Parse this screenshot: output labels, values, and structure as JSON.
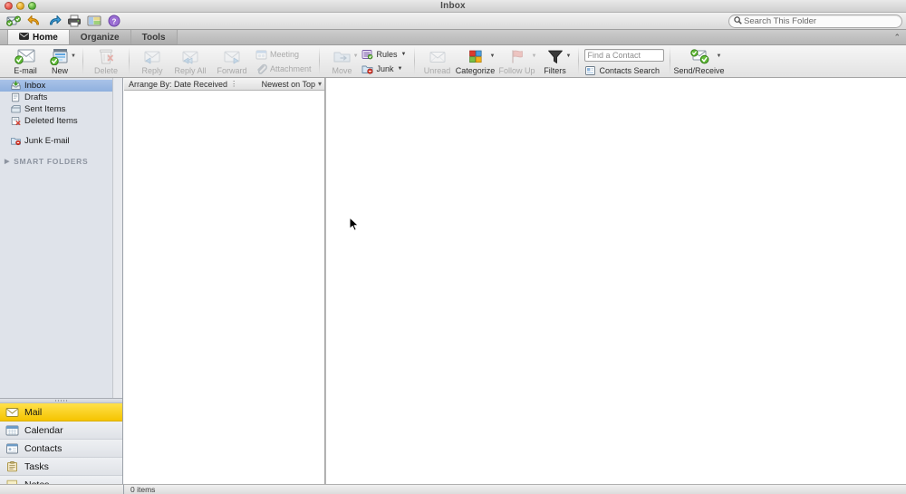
{
  "window": {
    "title": "Inbox",
    "controls": [
      "close",
      "minimize",
      "zoom"
    ]
  },
  "toolbar": {
    "icons": [
      {
        "name": "send-receive-icon",
        "label": "Send/Receive"
      },
      {
        "name": "undo-icon",
        "label": "Undo"
      },
      {
        "name": "redo-icon",
        "label": "Redo"
      },
      {
        "name": "print-icon",
        "label": "Print"
      },
      {
        "name": "sidebar-toggle-icon",
        "label": "View"
      },
      {
        "name": "help-icon",
        "label": "Help"
      }
    ],
    "search": {
      "placeholder": "Search This Folder",
      "value": "",
      "icon": "search-icon"
    }
  },
  "ribbon": {
    "tabs": [
      {
        "label": "Home",
        "active": true,
        "icon": "envelope-icon"
      },
      {
        "label": "Organize",
        "active": false
      },
      {
        "label": "Tools",
        "active": false
      }
    ],
    "collapse_glyph": "⌃",
    "groups": [
      {
        "name": "new-group",
        "buttons": [
          {
            "label": "E-mail",
            "icon": "new-email-icon",
            "disabled": false,
            "dropdown": false
          },
          {
            "label": "New",
            "icon": "new-item-icon",
            "disabled": false,
            "dropdown": true
          }
        ]
      },
      {
        "name": "delete-group",
        "buttons": [
          {
            "label": "Delete",
            "icon": "trash-icon",
            "disabled": true,
            "dropdown": false
          }
        ]
      },
      {
        "name": "respond-group",
        "buttons": [
          {
            "label": "Reply",
            "icon": "reply-icon",
            "disabled": true,
            "dropdown": false
          },
          {
            "label": "Reply All",
            "icon": "reply-all-icon",
            "disabled": true,
            "dropdown": false
          },
          {
            "label": "Forward",
            "icon": "forward-icon",
            "disabled": true,
            "dropdown": false
          }
        ],
        "stacked": [
          {
            "label": "Meeting",
            "icon": "meeting-icon",
            "disabled": true
          },
          {
            "label": "Attachment",
            "icon": "attachment-icon",
            "disabled": true
          }
        ]
      },
      {
        "name": "move-group",
        "buttons": [
          {
            "label": "Move",
            "icon": "move-folder-icon",
            "disabled": true,
            "dropdown": true
          }
        ],
        "stacked": [
          {
            "label": "Rules",
            "icon": "rules-icon",
            "disabled": false,
            "dropdown": true
          },
          {
            "label": "Junk",
            "icon": "junk-icon",
            "disabled": false,
            "dropdown": true
          }
        ]
      },
      {
        "name": "tags-group",
        "buttons": [
          {
            "label": "Unread",
            "icon": "unread-envelope-icon",
            "disabled": true,
            "dropdown": false
          },
          {
            "label": "Categorize",
            "icon": "categorize-icon",
            "disabled": false,
            "dropdown": true
          },
          {
            "label": "Follow Up",
            "icon": "flag-icon",
            "disabled": true,
            "dropdown": true
          },
          {
            "label": "Filters",
            "icon": "funnel-icon",
            "disabled": false,
            "dropdown": true
          }
        ]
      },
      {
        "name": "find-group",
        "find_contact": {
          "placeholder": "Find a Contact",
          "value": ""
        },
        "contacts_search": {
          "label": "Contacts Search",
          "icon": "contacts-search-icon"
        }
      },
      {
        "name": "sync-group",
        "buttons": [
          {
            "label": "Send/Receive",
            "icon": "send-receive-large-icon",
            "disabled": false,
            "dropdown": true
          }
        ]
      }
    ]
  },
  "sidebar": {
    "folders": [
      {
        "label": "Inbox",
        "icon": "inbox-icon",
        "selected": true
      },
      {
        "label": "Drafts",
        "icon": "drafts-icon",
        "selected": false
      },
      {
        "label": "Sent Items",
        "icon": "sent-icon",
        "selected": false
      },
      {
        "label": "Deleted Items",
        "icon": "deleted-icon",
        "selected": false
      },
      {
        "label": "Junk E-mail",
        "icon": "junk-folder-icon",
        "selected": false
      }
    ],
    "smart_folders": {
      "label": "SMART FOLDERS",
      "expanded": false,
      "disclosure_glyph": "▶"
    },
    "modules": [
      {
        "label": "Mail",
        "icon": "mail-module-icon",
        "active": true
      },
      {
        "label": "Calendar",
        "icon": "calendar-module-icon",
        "active": false
      },
      {
        "label": "Contacts",
        "icon": "contacts-module-icon",
        "active": false
      },
      {
        "label": "Tasks",
        "icon": "tasks-module-icon",
        "active": false
      },
      {
        "label": "Notes",
        "icon": "notes-module-icon",
        "active": false
      }
    ]
  },
  "message_list": {
    "arrange_by": "Arrange By: Date Received",
    "arrange_grip": "⋮",
    "sort_order": "Newest on Top",
    "sort_caret": "▾",
    "messages": []
  },
  "reading_pane": {
    "content": ""
  },
  "status_bar": {
    "text": "0 items"
  },
  "colors": {
    "accent_selected_folder": "#8fb0de",
    "module_active": "#f5c400",
    "sidebar_bg": "#dfe3ea",
    "ribbon_bg": "#eeeeee",
    "pane_bg": "#ffffff"
  }
}
